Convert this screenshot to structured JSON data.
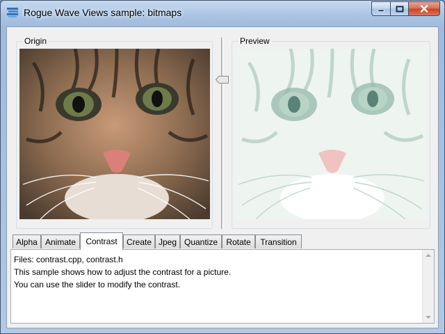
{
  "window": {
    "title": "Rogue Wave Views sample: bitmaps",
    "icon": "app-stack-icon"
  },
  "caption_buttons": [
    "minimize-icon",
    "maximize-icon",
    "close-icon"
  ],
  "panels": {
    "origin_label": "Origin",
    "preview_label": "Preview"
  },
  "contrast_slider": {
    "orientation": "vertical",
    "value_fraction": 0.2
  },
  "tabs": [
    {
      "label": "Alpha"
    },
    {
      "label": "Animate"
    },
    {
      "label": "Contrast"
    },
    {
      "label": "Create"
    },
    {
      "label": "Jpeg"
    },
    {
      "label": "Quantize"
    },
    {
      "label": "Rotate"
    },
    {
      "label": "Transition"
    }
  ],
  "active_tab": "Contrast",
  "description": {
    "lines": [
      "Files: contrast.cpp, contrast.h",
      "This sample shows how to adjust the contrast for a picture.",
      "You can use the slider to modify the contrast."
    ]
  },
  "colors": {
    "title_bar": "#a9c3e2",
    "client_bg": "#f0f0f0",
    "close_button": "#c64226",
    "group_border": "#d5dfe5"
  }
}
